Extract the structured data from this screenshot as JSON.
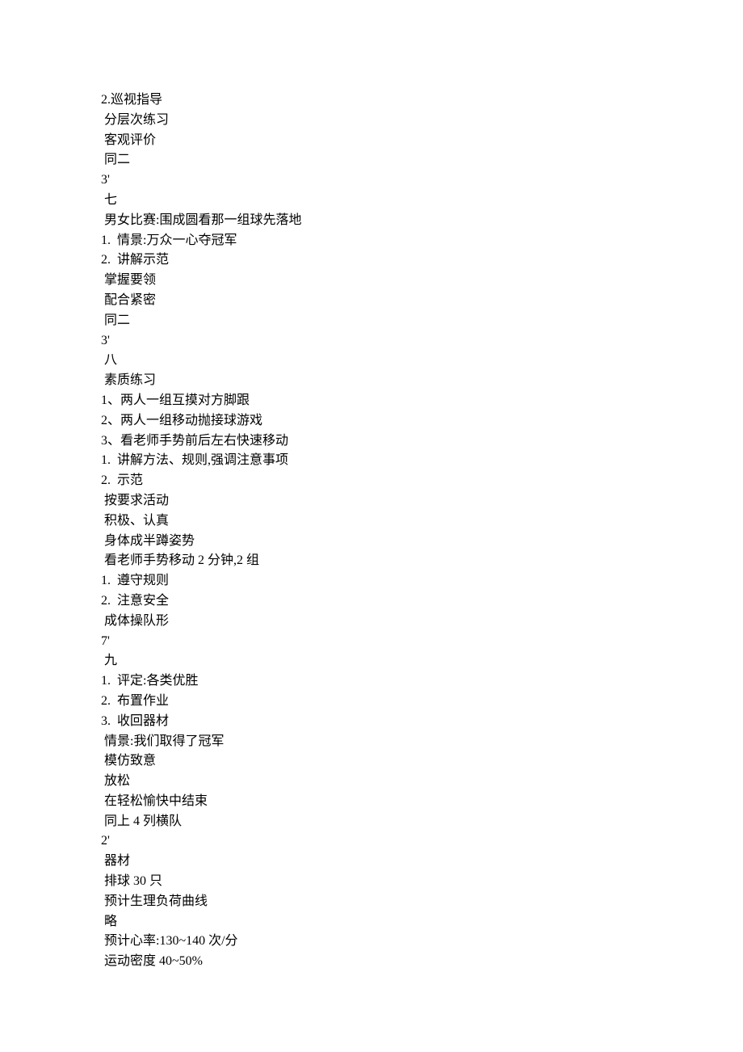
{
  "lines": [
    "2.巡视指导",
    " 分层次练习",
    " 客观评价",
    " 同二",
    "3'",
    " 七",
    " 男女比赛:围成圆看那一组球先落地",
    "1.  情景:万众一心夺冠军",
    "2.  讲解示范",
    " 掌握要领",
    " 配合紧密",
    " 同二",
    "3'",
    " 八",
    " 素质练习",
    "1、两人一组互摸对方脚跟",
    "2、两人一组移动抛接球游戏",
    "3、看老师手势前后左右快速移动",
    "1.  讲解方法、规则,强调注意事项",
    "2.  示范",
    " 按要求活动",
    " 积极、认真",
    " 身体成半蹲姿势",
    " 看老师手势移动 2 分钟,2 组",
    "1.  遵守规则",
    "2.  注意安全",
    " 成体操队形",
    "7'",
    " 九",
    "1.  评定:各类优胜",
    "2.  布置作业",
    "3.  收回器材",
    " 情景:我们取得了冠军",
    " 模仿致意",
    " 放松",
    " 在轻松愉快中结束",
    " 同上 4 列横队",
    "2'",
    " 器材",
    " 排球 30 只",
    " 预计生理负荷曲线",
    " 略",
    " 预计心率:130~140 次/分",
    " 运动密度 40~50%"
  ]
}
